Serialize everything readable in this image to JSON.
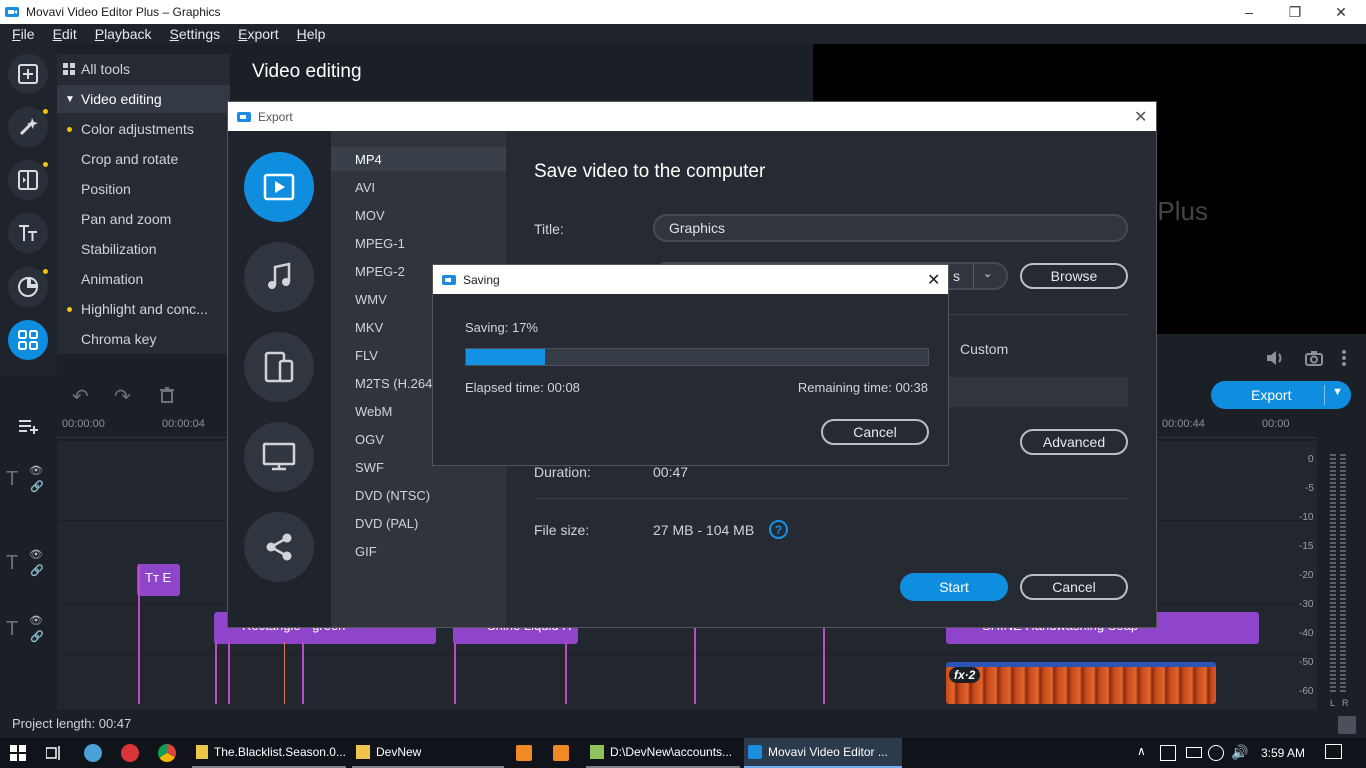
{
  "window": {
    "title": "Movavi Video Editor Plus – Graphics"
  },
  "menu": [
    {
      "key": "F",
      "rest": "ile"
    },
    {
      "key": "E",
      "rest": "dit"
    },
    {
      "key": "P",
      "rest": "layback"
    },
    {
      "key": "S",
      "rest": "ettings"
    },
    {
      "key": "E",
      "rest": "xport"
    },
    {
      "key": "H",
      "rest": "elp"
    }
  ],
  "tool_list": {
    "all_tools": "All tools",
    "section": "Video editing",
    "items": [
      "Color adjustments",
      "Crop and rotate",
      "Position",
      "Pan and zoom",
      "Stabilization",
      "Animation",
      "Highlight and conc...",
      "Chroma key"
    ]
  },
  "header": {
    "title": "Video editing"
  },
  "preview": {
    "text_partial": "Plus"
  },
  "timeline": {
    "ticks": [
      "00:00:00",
      "00:00:04",
      "00:00:44",
      "00:00"
    ],
    "clips": [
      "Rectangle - green",
      "Shine Liquid H",
      "SHINE Handwashing Soap"
    ],
    "text_clip": "E",
    "fx_badge": "fx·2",
    "export_button": "Export",
    "meter_labels": [
      "0",
      "-5",
      "-10",
      "-15",
      "-20",
      "-30",
      "-40",
      "-50",
      "-60"
    ],
    "meter_lr": [
      "L",
      "R"
    ]
  },
  "status": {
    "project_length": "Project length: 00:47"
  },
  "export_dialog": {
    "title": "Export",
    "formats": [
      "MP4",
      "AVI",
      "MOV",
      "MPEG-1",
      "MPEG-2",
      "WMV",
      "MKV",
      "FLV",
      "M2TS (H.264",
      "WebM",
      "OGV",
      "SWF",
      "DVD (NTSC)",
      "DVD (PAL)",
      "GIF"
    ],
    "heading": "Save video to the computer",
    "title_label": "Title:",
    "title_value": "Graphics",
    "folder_partial": "s",
    "browse": "Browse",
    "custom": "Custom",
    "advanced": "Advanced",
    "duration_label": "Duration:",
    "duration_value": "00:47",
    "filesize_label": "File size:",
    "filesize_value": "27 MB - 104 MB",
    "help_icon": "?",
    "start": "Start",
    "cancel": "Cancel"
  },
  "saving_dialog": {
    "title": "Saving",
    "status": "Saving:  17%",
    "progress": 0.17,
    "elapsed": "Elapsed time:  00:08",
    "remaining": "Remaining time:  00:38",
    "cancel": "Cancel"
  },
  "taskbar": {
    "items": [
      "The.Blacklist.Season.0...",
      "DevNew",
      "D:\\DevNew\\accounts...",
      "Movavi Video Editor ..."
    ],
    "time": "3:59 AM"
  },
  "colors": {
    "accent": "#0f8ee0",
    "clip_purple": "#8f45c9",
    "dot_yellow": "#f5c400"
  }
}
